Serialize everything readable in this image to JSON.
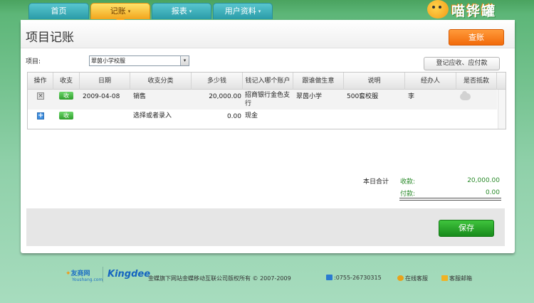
{
  "nav": {
    "tabs": [
      {
        "label": "首页",
        "has_caret": false
      },
      {
        "label": "记账",
        "has_caret": true,
        "active": true
      },
      {
        "label": "报表",
        "has_caret": true
      },
      {
        "label": "用户资料",
        "has_caret": true
      }
    ],
    "caret": "▾",
    "logo_text": "喵铧罐"
  },
  "header": {
    "title": "项目记账",
    "query_button": "查账"
  },
  "filters": {
    "project_label": "项目:",
    "project_value": "翠茵小学校服",
    "register_button": "登记应收、应付款"
  },
  "table": {
    "headers": [
      "操作",
      "收支",
      "日期",
      "收支分类",
      "多少钱",
      "钱记入哪个账户",
      "跟谁做生意",
      "说明",
      "经办人",
      "是否抵款"
    ],
    "rows": [
      {
        "action_icon": "delete-icon",
        "type": "收",
        "date": "2009-04-08",
        "category": "销售",
        "amount": "20,000.00",
        "account": "招商银行金色支行",
        "partner": "翠茵小学",
        "description": "500套校服",
        "handler": "李",
        "offset_icon": "cloud-icon"
      },
      {
        "action_icon": "add-icon",
        "type": "收",
        "date": "",
        "category": "选择或者录入",
        "amount": "0.00",
        "account": "现金",
        "partner": "",
        "description": "",
        "handler": ""
      }
    ]
  },
  "totals": {
    "label": "本日合计",
    "income_label": "收款:",
    "income_value": "20,000.00",
    "expense_label": "付款:",
    "expense_value": "0.00"
  },
  "actions": {
    "save_button": "保存"
  },
  "footer": {
    "brand1": "友商网",
    "brand1_sub": "Youshang.com",
    "brand2": "Kingdee",
    "copyright": "金蝶旗下网站金蝶移动互联公司版权所有 © 2007-2009",
    "phone": ":0755-26730315",
    "service": "在线客服",
    "mail": "客服邮箱"
  },
  "colors": {
    "accent_orange": "#f26a0a",
    "accent_green": "#188a1b",
    "nav_teal": "#2a9ba8",
    "income_green": "#2a8a2a"
  }
}
